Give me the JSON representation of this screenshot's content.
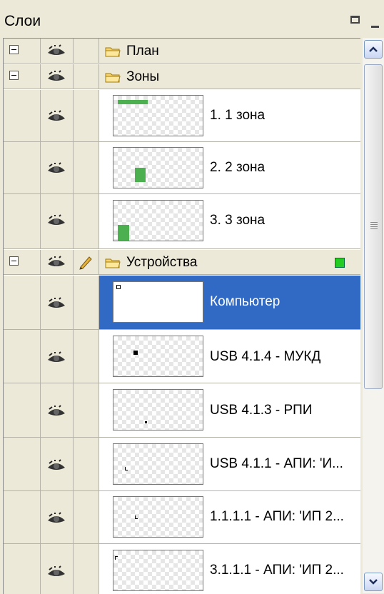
{
  "panel": {
    "title": "Слои",
    "restore_icon": "restore-window-icon",
    "minimize_icon": "minimize-icon"
  },
  "layers": [
    {
      "name": "План",
      "visible": true,
      "expanded": true,
      "children": []
    },
    {
      "name": "Зоны",
      "visible": true,
      "expanded": true,
      "children": [
        {
          "label": "1. 1 зона",
          "visible": true
        },
        {
          "label": "2. 2 зона",
          "visible": true
        },
        {
          "label": "3. 3 зона",
          "visible": true
        }
      ]
    },
    {
      "name": "Устройства",
      "visible": true,
      "editable": true,
      "expanded": true,
      "status_color": "#22cc22",
      "children": [
        {
          "label": "Компьютер",
          "visible": true,
          "selected": true
        },
        {
          "label": "USB 4.1.4 - МУКД",
          "visible": true
        },
        {
          "label": "USB 4.1.3 - РПИ",
          "visible": true
        },
        {
          "label": "USB 4.1.1 - АПИ: 'И...",
          "visible": true
        },
        {
          "label": "1.1.1.1 - АПИ: 'ИП 2...",
          "visible": true
        },
        {
          "label": "3.1.1.1 - АПИ: 'ИП 2...",
          "visible": true
        }
      ]
    }
  ],
  "colors": {
    "selection": "#316ac5",
    "zone_fill": "#4caf50",
    "panel_bg": "#ece9d8"
  }
}
